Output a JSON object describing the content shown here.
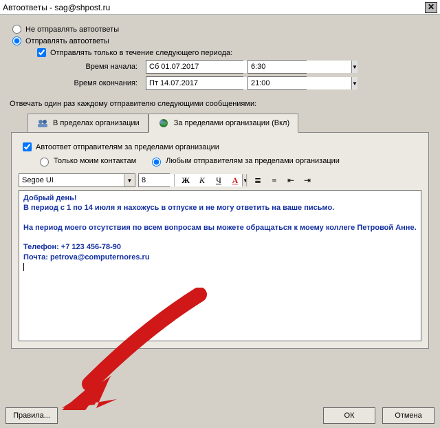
{
  "window": {
    "title": "Автоответы - sag@shpost.ru"
  },
  "options": {
    "do_not_send": "Не отправлять автоответы",
    "send": "Отправлять автоответы",
    "send_selected": true,
    "period_check": "Отправлять только в течение следующего периода:",
    "period_checked": true,
    "start_label": "Время начала:",
    "end_label": "Время окончания:",
    "start_date": "Сб 01.07.2017",
    "start_time": "6:30",
    "end_date": "Пт 14.07.2017",
    "end_time": "21:00"
  },
  "reply_section": {
    "label": "Отвечать один раз каждому отправителю следующими сообщениями:",
    "tab_inside": "В пределах организации",
    "tab_outside": "За пределами организации (Вкл)",
    "outside_check": "Автоответ отправителям за пределами организации",
    "outside_checked": true,
    "only_contacts": "Только моим контактам",
    "anyone": "Любым отправителям за пределами организации",
    "anyone_selected": true
  },
  "editor": {
    "font_name": "Segoe UI",
    "font_size": "8",
    "body_lines": [
      "Добрый день!",
      "В период с 1 по 14 июля я нахожусь в отпуске и не могу ответить на ваше письмо.",
      "",
      "На период моего отсутствия по всем вопросам вы можете обращаться к моему коллеге Петровой Анне.",
      "",
      "Телефон: +7 123 456-78-90",
      "Почта: petrova@computernores.ru"
    ]
  },
  "buttons": {
    "rules": "Правила...",
    "ok": "ОК",
    "cancel": "Отмена"
  },
  "toolbar_glyphs": {
    "bold": "Ж",
    "italic": "К",
    "underline": "Ч",
    "color": "А",
    "bullets": "≣",
    "numbers": "≡",
    "outdent": "⇤",
    "indent": "⇥"
  }
}
